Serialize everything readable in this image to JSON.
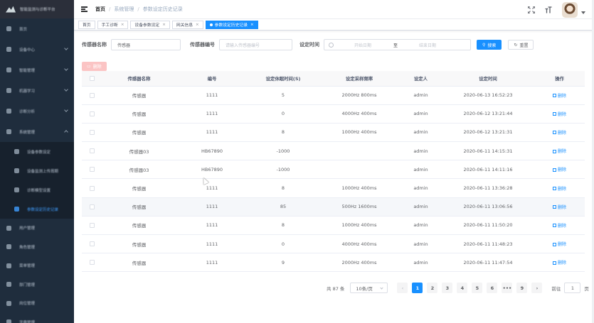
{
  "sidebar": {
    "brand": "智能监测与诊断平台",
    "menu": [
      {
        "label": "首页",
        "icon": "dashboard-icon",
        "has_arrow": false
      },
      {
        "label": "设备中心",
        "icon": "device-icon",
        "has_arrow": true
      },
      {
        "label": "智能管理",
        "icon": "manage-icon",
        "has_arrow": true
      },
      {
        "label": "机器学习",
        "icon": "learning-icon",
        "has_arrow": true
      },
      {
        "label": "诊断分析",
        "icon": "analysis-icon",
        "has_arrow": true
      },
      {
        "label": "系统管理",
        "icon": "system-icon",
        "has_arrow": true,
        "expanded": true
      }
    ],
    "submenu": [
      {
        "label": "设备参数设定",
        "icon": "shield-icon"
      },
      {
        "label": "设备监测上传周期",
        "icon": "shield-icon"
      },
      {
        "label": "诊断模型设置",
        "icon": "list-icon"
      },
      {
        "label": "参数设定历史记录",
        "icon": "history-icon",
        "active": true
      }
    ],
    "tail": [
      {
        "label": "用户管理",
        "icon": "user-icon"
      },
      {
        "label": "角色管理",
        "icon": "role-icon"
      },
      {
        "label": "菜单管理",
        "icon": "menu-icon"
      },
      {
        "label": "部门管理",
        "icon": "dept-icon"
      },
      {
        "label": "岗位管理",
        "icon": "post-icon"
      },
      {
        "label": "字典管理",
        "icon": "dict-icon"
      }
    ]
  },
  "navbar": {
    "breadcrumb": [
      "首页",
      "系统管理",
      "参数设定历史记录"
    ],
    "size_icon_text": "тT"
  },
  "tags": [
    {
      "label": "首页",
      "closable": false,
      "active": false
    },
    {
      "label": "手工诊断",
      "closable": true,
      "active": false
    },
    {
      "label": "设备参数设定",
      "closable": true,
      "active": false
    },
    {
      "label": "网关信息",
      "closable": true,
      "active": false
    },
    {
      "label": "参数设定历史记录",
      "closable": true,
      "active": true
    }
  ],
  "search": {
    "sensor_name_label": "传感器名称",
    "sensor_name_value": "传感器",
    "sensor_code_label": "传感器编号",
    "sensor_code_placeholder": "请输入传感器编号",
    "time_label": "设定时间",
    "start_placeholder": "开始日期",
    "range_sep": "至",
    "end_placeholder": "结束日期",
    "search_btn": "搜索",
    "reset_btn": "重置"
  },
  "toolbar": {
    "delete_btn": "删除"
  },
  "table": {
    "headers": [
      "传感器名称",
      "编号",
      "设定休眠时间(S)",
      "设定采样频率",
      "设定人",
      "设定时间",
      "操作"
    ],
    "op_label": "删除",
    "rows": [
      [
        "传感器",
        "1111",
        "5",
        "2000Hz 800ms",
        "admin",
        "2020-06-13 16:52:23"
      ],
      [
        "传感器",
        "1111",
        "0",
        "4000Hz 400ms",
        "admin",
        "2020-06-12 13:21:44"
      ],
      [
        "传感器",
        "1111",
        "8",
        "1000Hz 400ms",
        "admin",
        "2020-06-12 13:21:31"
      ],
      [
        "传感器03",
        "HB67890",
        "-1000",
        "",
        "admin",
        "2020-06-11 14:15:31"
      ],
      [
        "传感器03",
        "HB67890",
        "-1000",
        "",
        "admin",
        "2020-06-11 14:11:16"
      ],
      [
        "传感器",
        "1111",
        "8",
        "1000Hz 400ms",
        "admin",
        "2020-06-11 13:36:28"
      ],
      [
        "传感器",
        "1111",
        "85",
        "500Hz 1600ms",
        "admin",
        "2020-06-11 13:06:56"
      ],
      [
        "传感器",
        "1111",
        "8",
        "1000Hz 400ms",
        "admin",
        "2020-06-11 11:50:20"
      ],
      [
        "传感器",
        "1111",
        "0",
        "4000Hz 400ms",
        "admin",
        "2020-06-11 11:48:23"
      ],
      [
        "传感器",
        "1111",
        "9",
        "2000Hz 400ms",
        "admin",
        "2020-06-11 11:47:54"
      ]
    ]
  },
  "pagination": {
    "total": "共 87 条",
    "page_size": "10条/页",
    "prev": "‹",
    "pages": [
      "1",
      "2",
      "3",
      "4",
      "5",
      "6",
      "•••",
      "9"
    ],
    "next": "›",
    "goto_label": "前往",
    "goto_value": "1",
    "page_unit": "页"
  },
  "colors": {
    "primary": "#1890ff",
    "sidebar_bg": "#1f2d3d",
    "danger_disabled": "#fbc4c4"
  }
}
